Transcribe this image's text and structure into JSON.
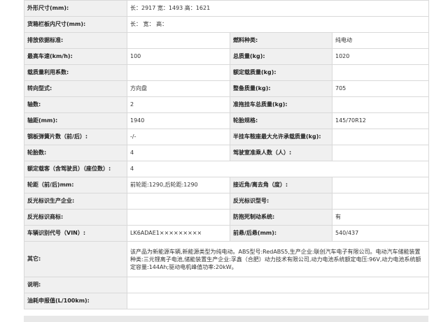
{
  "rows": [
    {
      "type": "wide",
      "label": "外形尺寸(mm):",
      "value": "长：2917 宽：1493 高：1621"
    },
    {
      "type": "wide",
      "label": "货箱栏板内尺寸(mm):",
      "value": "长：  宽：  高："
    },
    {
      "type": "pair",
      "l1": "排放依据标准:",
      "v1": "",
      "l2": "燃料种类:",
      "v2": "纯电动"
    },
    {
      "type": "pair",
      "l1": "最高车速(km/h):",
      "v1": "100",
      "l2": "总质量(kg):",
      "v2": "1020"
    },
    {
      "type": "pair",
      "l1": "载质量利用系数:",
      "v1": "",
      "l2": "额定载质量(kg):",
      "v2": ""
    },
    {
      "type": "pair",
      "l1": "转向型式:",
      "v1": "方向盘",
      "l2": "整备质量(kg):",
      "v2": "705"
    },
    {
      "type": "pair",
      "l1": "轴数:",
      "v1": "2",
      "l2": "准拖挂车总质量(kg):",
      "v2": ""
    },
    {
      "type": "pair",
      "l1": "轴距(mm):",
      "v1": "1940",
      "l2": "轮胎规格:",
      "v2": "145/70R12"
    },
    {
      "type": "pair",
      "l1": "钢板弹簧片数（前/后）:",
      "v1": "-/-",
      "l2": "半挂车鞍座最大允许承载质量(kg):",
      "v2": ""
    },
    {
      "type": "pair",
      "l1": "轮胎数:",
      "v1": "4",
      "l2": "驾驶室准乘人数（人）:",
      "v2": ""
    },
    {
      "type": "wide",
      "label": "额定载客（含驾驶员）（座位数）:",
      "value": "4"
    },
    {
      "type": "pair",
      "l1": "轮距（前/后)mm:",
      "v1": "前轮距:1290,后轮距:1290",
      "l2": "接近角/离去角（度）:",
      "v2": ""
    },
    {
      "type": "pair",
      "l1": "反光标识生产企业:",
      "v1": "",
      "l2": "反光标识型号:",
      "v2": ""
    },
    {
      "type": "pair",
      "l1": "反光标识商标:",
      "v1": "",
      "l2": "防抱死制动系统:",
      "v2": "有"
    },
    {
      "type": "pair",
      "l1": "车辆识别代号（VIN）:",
      "v1": "LK6ADAE1×××××××××",
      "l2": "前悬/后悬(mm):",
      "v2": "540/437"
    },
    {
      "type": "other",
      "label": "其它:",
      "value": "该产品为新能源车辆,新能源类型为纯电动。ABS型号:RedABS5,生产企业:联创汽车电子有限公司。电动汽车储能装置种类:三元锂离子电池,储能装置生产企业:孚鑫（合肥）动力技术有限公司,动力电池系统额定电压:96V,动力电池系统额定容量:144Ah;驱动电机峰值功率:20kW。"
    },
    {
      "type": "wide",
      "label": "说明:",
      "value": ""
    },
    {
      "type": "wide",
      "label": "油耗申报值(L/100km):",
      "value": ""
    }
  ]
}
